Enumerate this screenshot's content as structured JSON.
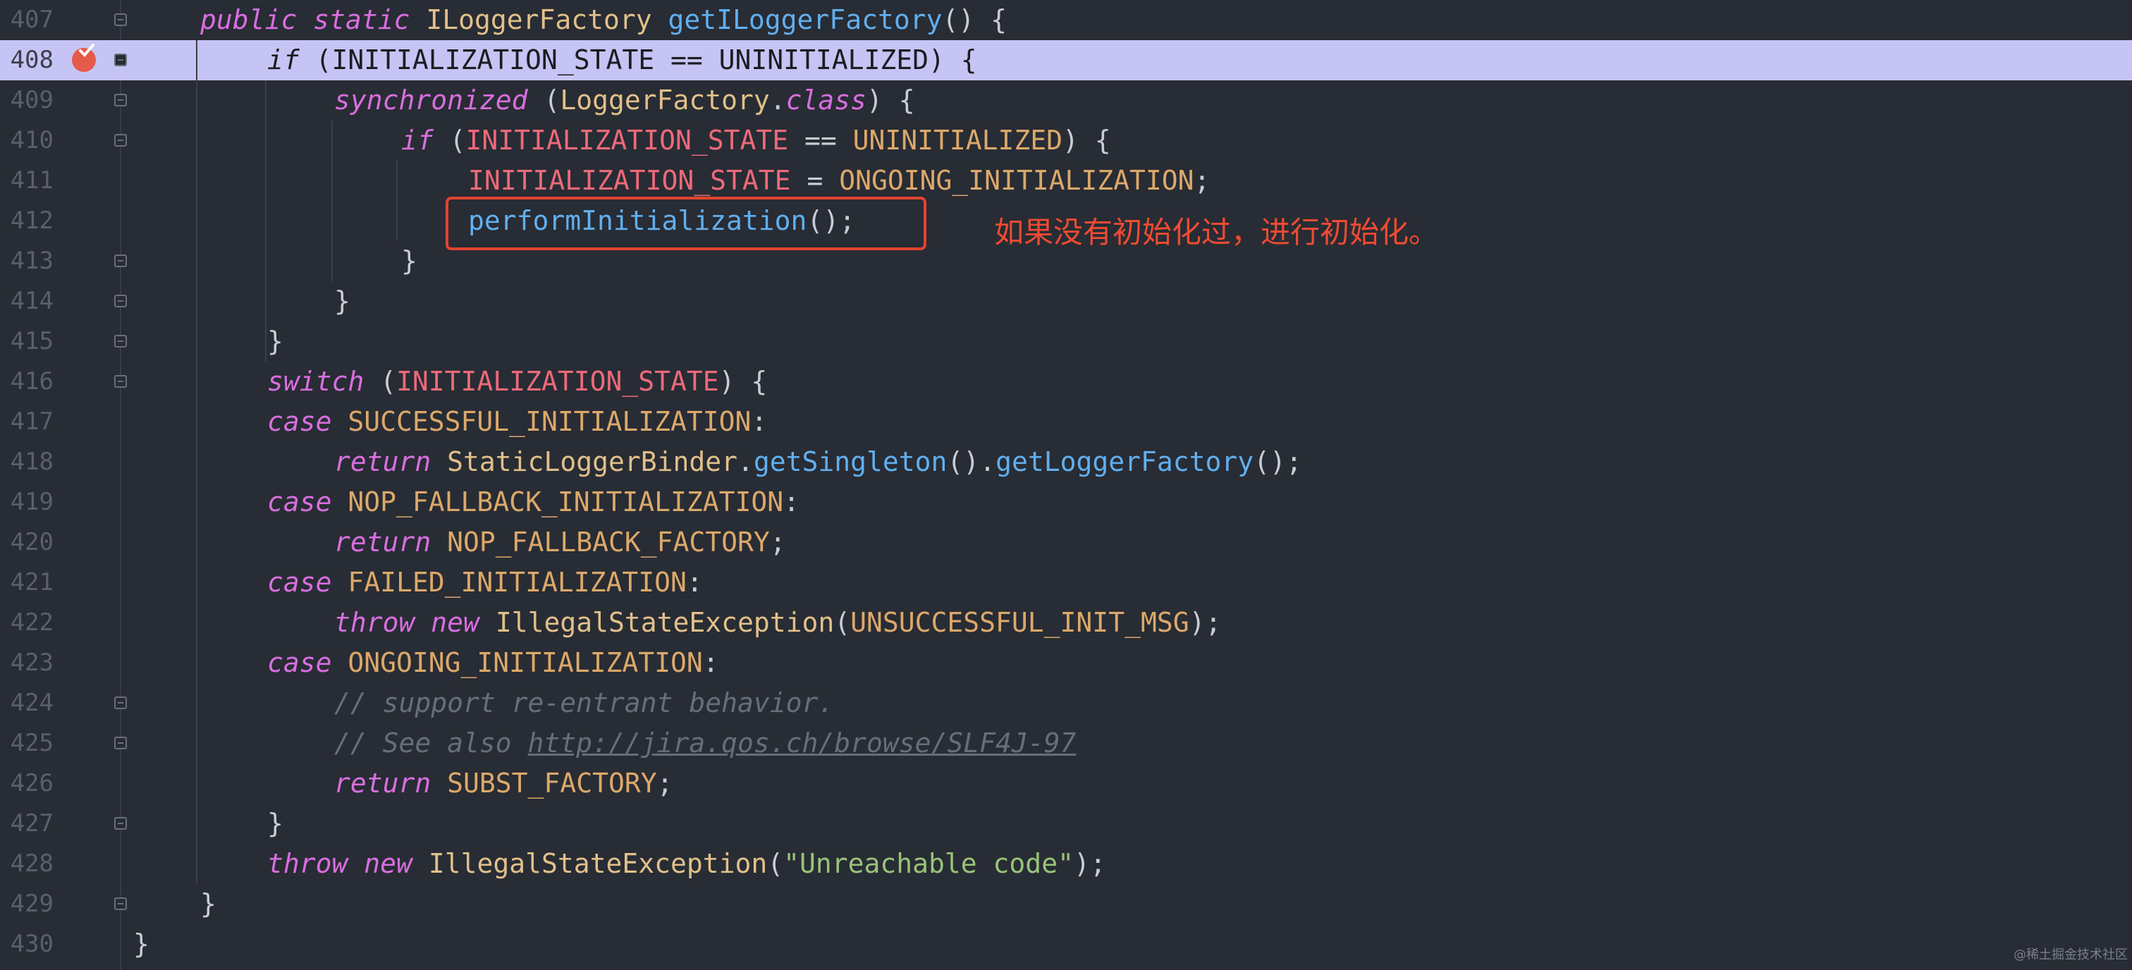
{
  "editor": {
    "lines": [
      {
        "no": "407",
        "tokens": [
          [
            "kw",
            "public"
          ],
          [
            "plain",
            " "
          ],
          [
            "kw",
            "static"
          ],
          [
            "plain",
            " "
          ],
          [
            "type",
            "ILoggerFactory"
          ],
          [
            "plain",
            " "
          ],
          [
            "fn",
            "getILoggerFactory"
          ],
          [
            "plain",
            "() {"
          ]
        ]
      },
      {
        "no": "408",
        "tokens": [
          [
            "kw",
            "if"
          ],
          [
            "plain",
            " (INITIALIZATION_STATE == UNINITIALIZED) {"
          ]
        ]
      },
      {
        "no": "409",
        "tokens": [
          [
            "kw",
            "synchronized"
          ],
          [
            "plain",
            " ("
          ],
          [
            "type",
            "LoggerFactory"
          ],
          [
            "plain",
            "."
          ],
          [
            "kw",
            "class"
          ],
          [
            "plain",
            ") {"
          ]
        ]
      },
      {
        "no": "410",
        "tokens": [
          [
            "kw",
            "if"
          ],
          [
            "plain",
            " ("
          ],
          [
            "cnst",
            "INITIALIZATION_STATE"
          ],
          [
            "plain",
            " == "
          ],
          [
            "enum",
            "UNINITIALIZED"
          ],
          [
            "plain",
            ") {"
          ]
        ]
      },
      {
        "no": "411",
        "tokens": [
          [
            "cnst",
            "INITIALIZATION_STATE"
          ],
          [
            "plain",
            " = "
          ],
          [
            "enum",
            "ONGOING_INITIALIZATION"
          ],
          [
            "plain",
            ";"
          ]
        ]
      },
      {
        "no": "412",
        "tokens": [
          [
            "fn",
            "performInitialization"
          ],
          [
            "plain",
            "();"
          ]
        ]
      },
      {
        "no": "413",
        "tokens": [
          [
            "plain",
            "}"
          ]
        ]
      },
      {
        "no": "414",
        "tokens": [
          [
            "plain",
            "}"
          ]
        ]
      },
      {
        "no": "415",
        "tokens": [
          [
            "plain",
            "}"
          ]
        ]
      },
      {
        "no": "416",
        "tokens": [
          [
            "kw",
            "switch"
          ],
          [
            "plain",
            " ("
          ],
          [
            "cnst",
            "INITIALIZATION_STATE"
          ],
          [
            "plain",
            ") {"
          ]
        ]
      },
      {
        "no": "417",
        "tokens": [
          [
            "kw",
            "case"
          ],
          [
            "plain",
            " "
          ],
          [
            "enum",
            "SUCCESSFUL_INITIALIZATION"
          ],
          [
            "plain",
            ":"
          ]
        ]
      },
      {
        "no": "418",
        "tokens": [
          [
            "kw",
            "return"
          ],
          [
            "plain",
            " "
          ],
          [
            "type",
            "StaticLoggerBinder"
          ],
          [
            "plain",
            "."
          ],
          [
            "fn",
            "getSingleton"
          ],
          [
            "plain",
            "()."
          ],
          [
            "fn",
            "getLoggerFactory"
          ],
          [
            "plain",
            "();"
          ]
        ]
      },
      {
        "no": "419",
        "tokens": [
          [
            "kw",
            "case"
          ],
          [
            "plain",
            " "
          ],
          [
            "enum",
            "NOP_FALLBACK_INITIALIZATION"
          ],
          [
            "plain",
            ":"
          ]
        ]
      },
      {
        "no": "420",
        "tokens": [
          [
            "kw",
            "return"
          ],
          [
            "plain",
            " "
          ],
          [
            "enum",
            "NOP_FALLBACK_FACTORY"
          ],
          [
            "plain",
            ";"
          ]
        ]
      },
      {
        "no": "421",
        "tokens": [
          [
            "kw",
            "case"
          ],
          [
            "plain",
            " "
          ],
          [
            "enum",
            "FAILED_INITIALIZATION"
          ],
          [
            "plain",
            ":"
          ]
        ]
      },
      {
        "no": "422",
        "tokens": [
          [
            "kw",
            "throw"
          ],
          [
            "plain",
            " "
          ],
          [
            "kw",
            "new"
          ],
          [
            "plain",
            " "
          ],
          [
            "type",
            "IllegalStateException"
          ],
          [
            "plain",
            "("
          ],
          [
            "enum",
            "UNSUCCESSFUL_INIT_MSG"
          ],
          [
            "plain",
            ");"
          ]
        ]
      },
      {
        "no": "423",
        "tokens": [
          [
            "kw",
            "case"
          ],
          [
            "plain",
            " "
          ],
          [
            "enum",
            "ONGOING_INITIALIZATION"
          ],
          [
            "plain",
            ":"
          ]
        ]
      },
      {
        "no": "424",
        "tokens": [
          [
            "cmt",
            "// support re-entrant behavior."
          ]
        ]
      },
      {
        "no": "425",
        "tokens": [
          [
            "cmt",
            "// See also "
          ],
          [
            "lnk",
            "http://jira.qos.ch/browse/SLF4J-97"
          ]
        ]
      },
      {
        "no": "426",
        "tokens": [
          [
            "kw",
            "return"
          ],
          [
            "plain",
            " "
          ],
          [
            "enum",
            "SUBST_FACTORY"
          ],
          [
            "plain",
            ";"
          ]
        ]
      },
      {
        "no": "427",
        "tokens": [
          [
            "plain",
            "}"
          ]
        ]
      },
      {
        "no": "428",
        "tokens": [
          [
            "kw",
            "throw"
          ],
          [
            "plain",
            " "
          ],
          [
            "kw",
            "new"
          ],
          [
            "plain",
            " "
          ],
          [
            "type",
            "IllegalStateException"
          ],
          [
            "plain",
            "("
          ],
          [
            "str",
            "\"Unreachable code\""
          ],
          [
            "plain",
            ");"
          ]
        ]
      },
      {
        "no": "429",
        "tokens": [
          [
            "plain",
            "}"
          ]
        ]
      },
      {
        "no": "430",
        "tokens": [
          [
            "plain",
            "}"
          ]
        ]
      }
    ]
  },
  "annotation": {
    "text": "如果没有初始化过，进行初始化。"
  },
  "watermark": {
    "text": "@稀土掘金技术社区"
  },
  "colors": {
    "background": "#282c34",
    "current_line": "#c6c4f4",
    "annotation_red": "#e2442f"
  },
  "icons": {
    "breakpoint": "breakpoint-check-icon",
    "fold": "fold-marker-icon"
  }
}
